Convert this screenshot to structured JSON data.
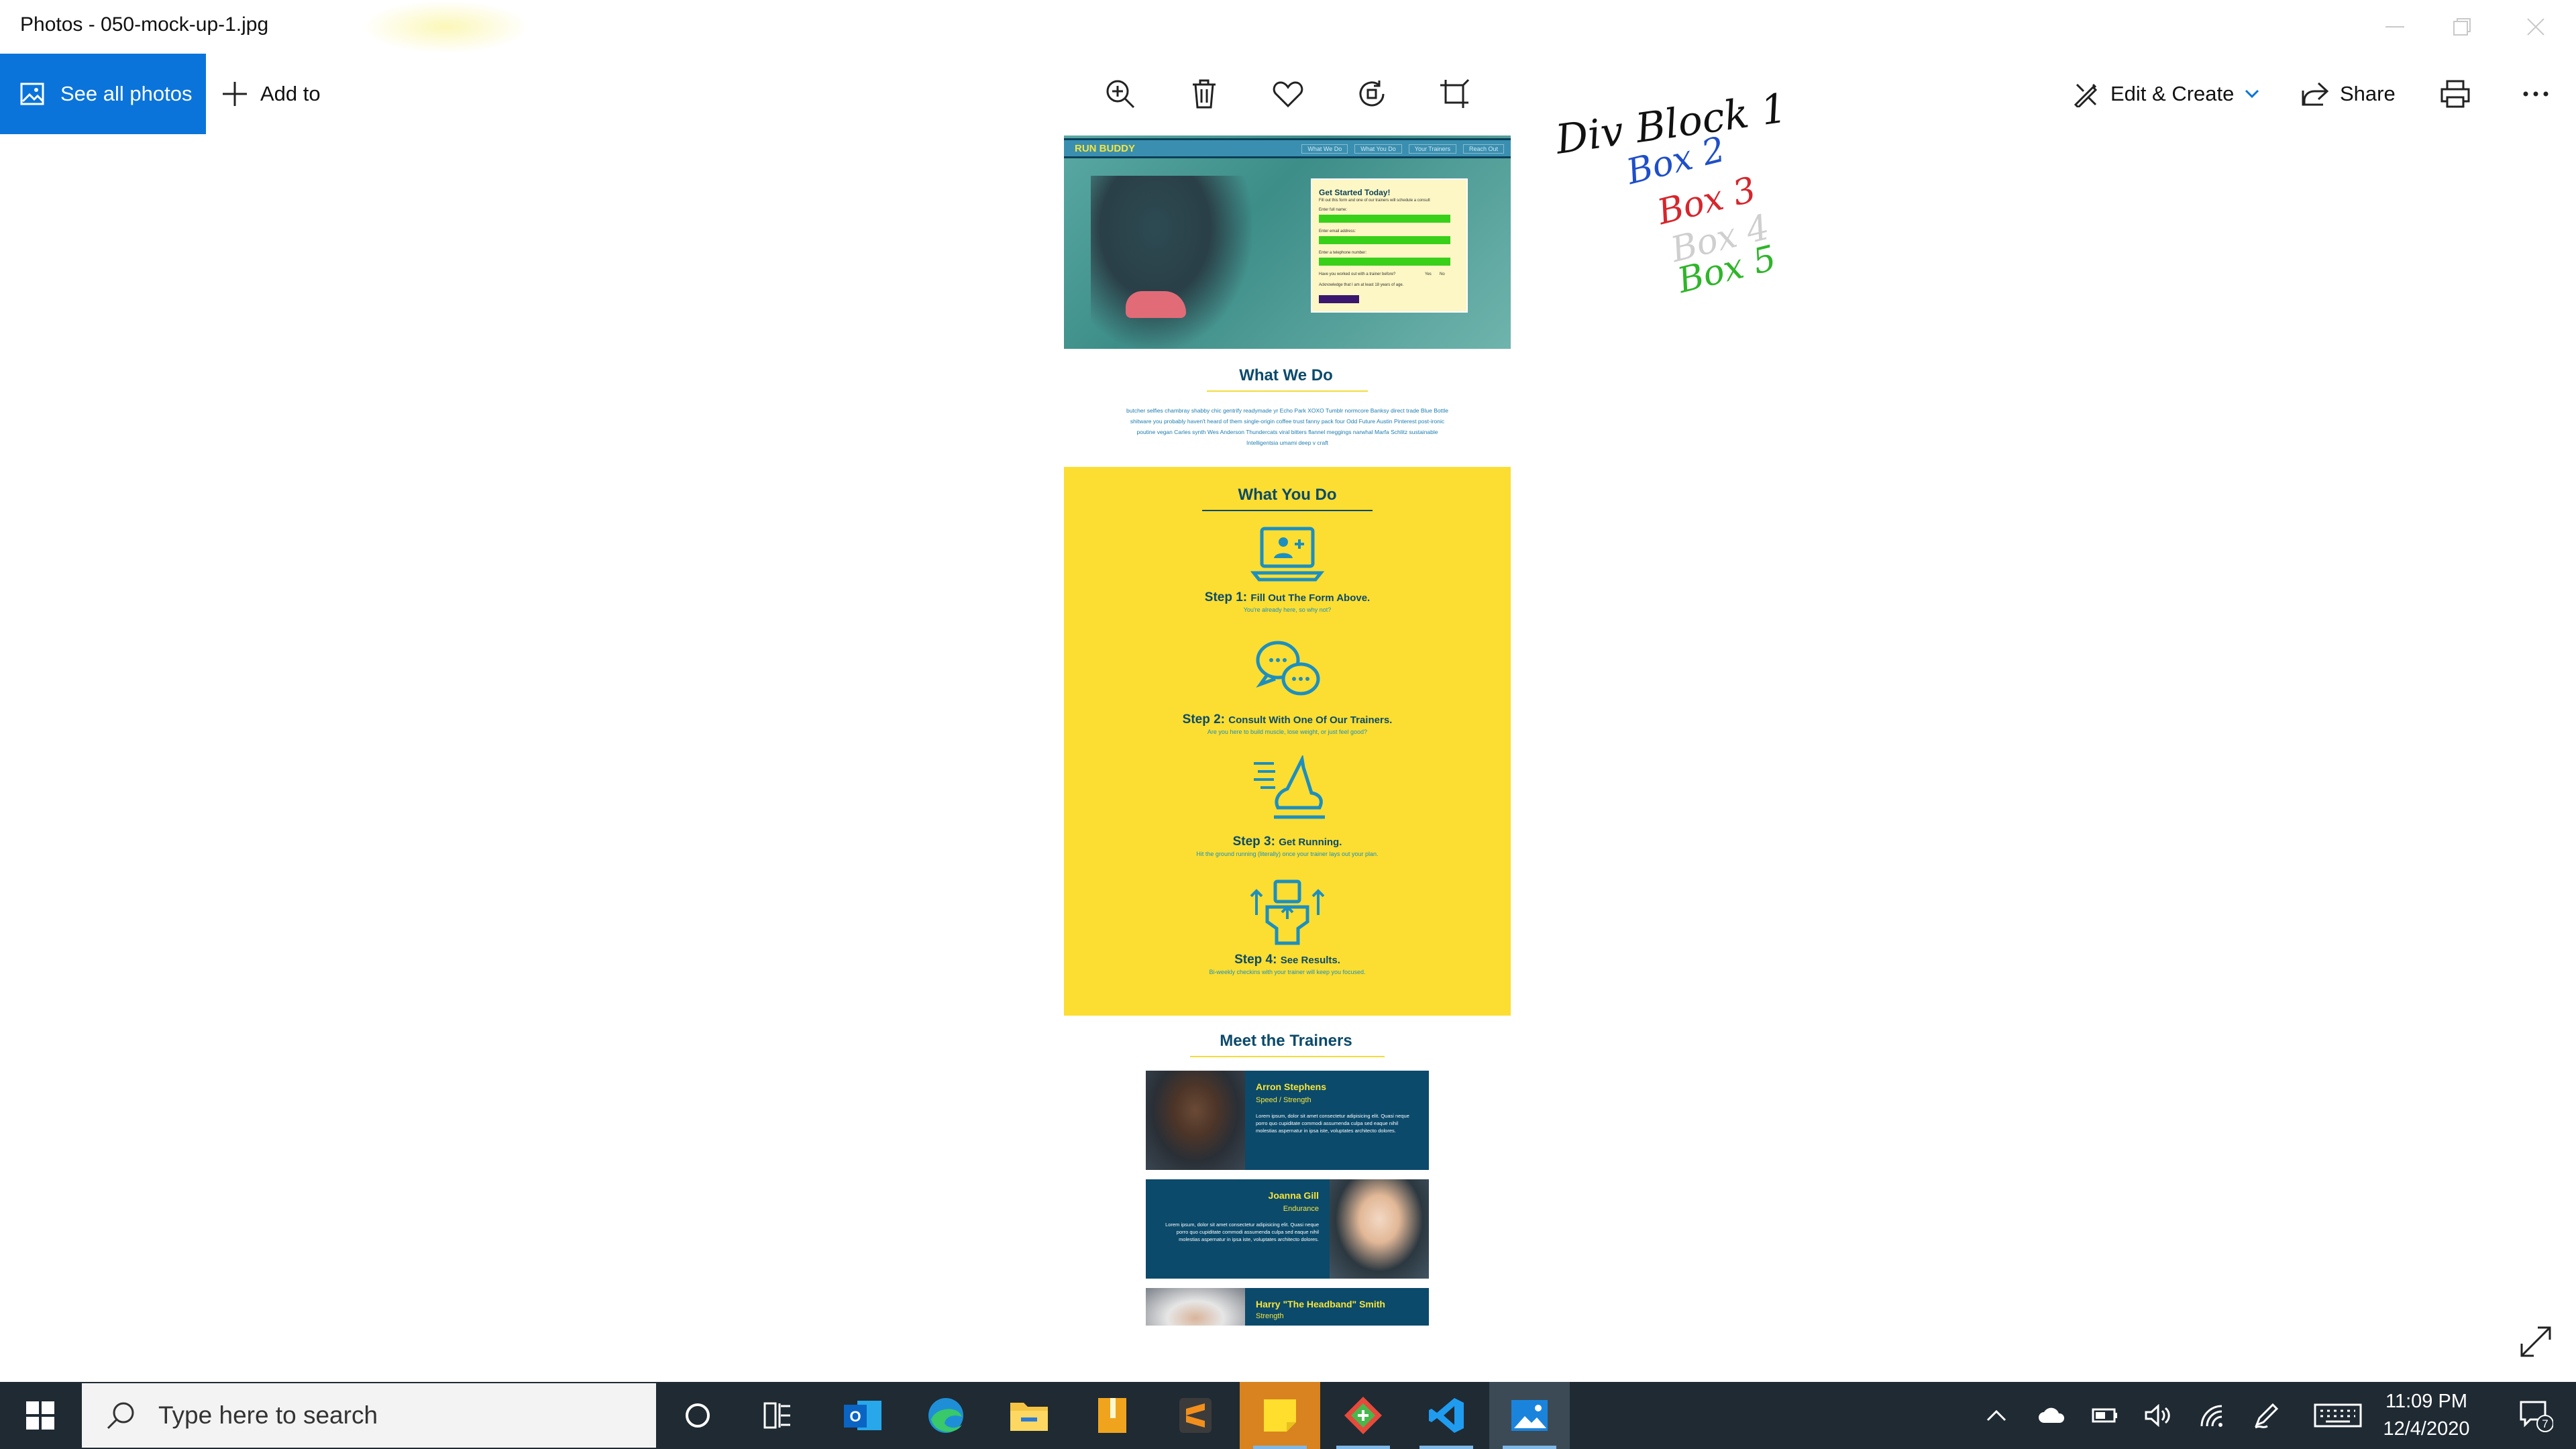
{
  "window": {
    "title": "Photos - 050-mock-up-1.jpg"
  },
  "toolbar": {
    "see_all_label": "See all photos",
    "add_to_label": "Add to",
    "edit_create_label": "Edit & Create",
    "share_label": "Share",
    "center_icons": [
      "zoom-in-icon",
      "delete-icon",
      "favorite-icon",
      "rotate-icon",
      "crop-icon"
    ]
  },
  "mockup": {
    "brand": "RUN BUDDY",
    "nav_links": [
      "What We Do",
      "What You Do",
      "Your Trainers",
      "Reach Out"
    ],
    "form": {
      "title": "Get Started Today!",
      "subtitle": "Fill out this form and one of our trainers will schedule a consult",
      "fields": [
        "Enter full name:",
        "Enter email address:",
        "Enter a telephone number:",
        "Have you worked out with a trainer before?",
        "Acknowledge that I am at least 18 years of age."
      ],
      "yes": "Yes",
      "no": "No"
    },
    "what_we_do": {
      "title": "What We Do",
      "text": "butcher selfies chambray shabby chic gentrify readymade yr Echo Park XOXO Tumblr normcore Banksy direct trade Blue Bottle shitware you probably haven't heard of them single-origin coffee trust fanny pack four Odd Future Austin Pinterest post-ironic poutine vegan Carles synth Wes Anderson Thundercats viral bitters flannel meggings narwhal Marfa Schlitz sustainable Intelligentsia umami deep v craft"
    },
    "what_you_do": {
      "title": "What You Do",
      "steps": [
        {
          "label": "Step 1:",
          "title": "Fill Out The Form Above.",
          "desc": "You're already here, so why not?",
          "icon": "laptop-user-icon"
        },
        {
          "label": "Step 2:",
          "title": "Consult With One Of Our Trainers.",
          "desc": "Are you here to build muscle, lose weight, or just feel good?",
          "icon": "chat-bubbles-icon"
        },
        {
          "label": "Step 3:",
          "title": "Get Running.",
          "desc": "Hit the ground running (literally) once your trainer lays out your plan.",
          "icon": "running-shoe-icon"
        },
        {
          "label": "Step 4:",
          "title": "See Results.",
          "desc": "Bi-weekly checkins with your trainer will keep you focused.",
          "icon": "results-icon"
        }
      ]
    },
    "trainers": {
      "title": "Meet the Trainers",
      "items": [
        {
          "name": "Arron Stephens",
          "specialty": "Speed / Strength",
          "bio": "Lorem ipsum, dolor sit amet consectetur adipisicing elit. Quasi neque porro quo cupiditate commodi assumenda culpa sed eaque nihil molestias aspernatur in ipsa iste, voluptates architecto dolores."
        },
        {
          "name": "Joanna Gill",
          "specialty": "Endurance",
          "bio": "Lorem ipsum, dolor sit amet consectetur adipisicing elit. Quasi neque porro quo cupiditate commodi assumenda culpa sed eaque nihil molestias aspernatur in ipsa iste, voluptates architecto dolores."
        },
        {
          "name": "Harry \"The Headband\" Smith",
          "specialty": "Strength",
          "bio": ""
        }
      ]
    }
  },
  "annotation": {
    "lines": [
      {
        "text": "Div Block 1",
        "color": "#111111"
      },
      {
        "text": "Box 2",
        "color": "#1f4fc8"
      },
      {
        "text": "Box 3",
        "color": "#d6262c"
      },
      {
        "text": "Box 4",
        "color": "#cfcfcf"
      },
      {
        "text": "Box 5",
        "color": "#2fb52a"
      }
    ]
  },
  "taskbar": {
    "search_placeholder": "Type here to search",
    "time": "11:09 PM",
    "date": "12/4/2020",
    "notification_count": "7",
    "apps": [
      "cortana-icon",
      "task-view-icon",
      "outlook-icon",
      "edge-icon",
      "file-explorer-icon",
      "archive-app-icon",
      "sublime-text-icon",
      "sticky-notes-icon",
      "git-app-icon",
      "vscode-icon",
      "photos-icon"
    ]
  },
  "colors": {
    "accent": "#0a74da",
    "mockup_yellow": "#fbde31",
    "mockup_navy": "#0b4a6b",
    "taskbar": "#1f2a33"
  }
}
